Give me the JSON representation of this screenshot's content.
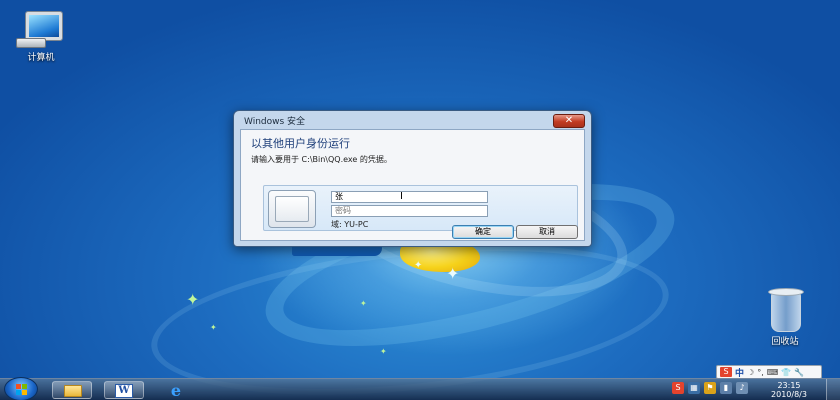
{
  "desktop": {
    "icons": [
      {
        "label": "计算机"
      },
      {
        "label": "回收站"
      }
    ]
  },
  "dialog": {
    "title": "Windows 安全",
    "close_symbol": "✕",
    "heading": "以其他用户身份运行",
    "subheading": "请输入要用于 C:\\Bin\\QQ.exe 的凭据。",
    "username_value": "张",
    "password_placeholder": "密码",
    "domain_text": "域: YU-PC",
    "ok_label": "确定",
    "cancel_label": "取消"
  },
  "taskbar": {
    "clock_time": "23:15",
    "clock_date": "2010/8/3",
    "word_icon_letter": "W",
    "ie_icon_letter": "e"
  },
  "ime": {
    "s_label": "S",
    "mode_label": "中",
    "symbols": [
      "☽",
      "°,",
      "⌨",
      "👕",
      "🔧"
    ]
  },
  "colors": {
    "desktop_blue": "#1d6cc0",
    "dialog_frame": "#c4d7ec",
    "close_red": "#c23b22",
    "heading_blue": "#1e3f7a"
  }
}
